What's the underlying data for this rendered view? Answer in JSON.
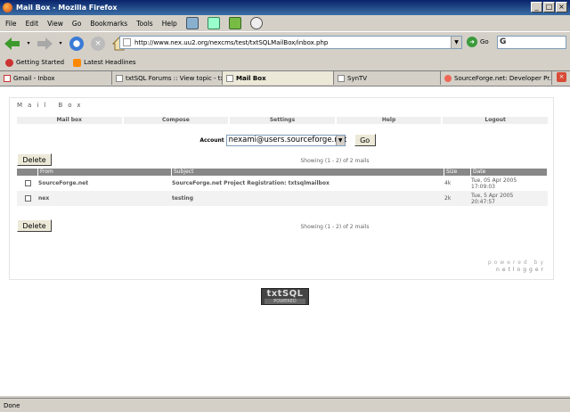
{
  "window": {
    "title": "Mail Box - Mozilla Firefox"
  },
  "menu": [
    "File",
    "Edit",
    "View",
    "Go",
    "Bookmarks",
    "Tools",
    "Help"
  ],
  "navigation": {
    "url": "http://www.nex.uu2.org/nexcms/test/txtSQLMailBox/inbox.php",
    "go_label": "Go",
    "search_icon_label": "G"
  },
  "bookmarks": [
    "Getting Started",
    "Latest Headlines"
  ],
  "tabs": [
    "Gmail - Inbox",
    "txtSQL Forums :: View topic - txt...",
    "Mail Box",
    "SynTV",
    "SourceForge.net: Developer Pr..."
  ],
  "active_tab": 2,
  "page": {
    "title": "Mail Box",
    "nav": [
      "Mail box",
      "Compose",
      "Settings",
      "Help",
      "Logout"
    ],
    "account_label": "Account",
    "account_value": "nexami@users.sourceforge.net",
    "go_button": "Go",
    "delete_button": "Delete",
    "showing_text": "Showing (1 - 2) of 2 mails",
    "columns": [
      "From",
      "Subject",
      "Size",
      "Date"
    ],
    "rows": [
      {
        "from": "SourceForge.net",
        "subject": "SourceForge.net Project Registration: txtsqlmailbox",
        "size": "4k",
        "date1": "Tue, 05 Apr 2005",
        "date2": "17:09:03"
      },
      {
        "from": "nex",
        "subject": "testing",
        "size": "2k",
        "date1": "Tue, 5 Apr 2005",
        "date2": "20:47:57"
      }
    ],
    "powered_by": "powered by",
    "powered_name": "netlogger",
    "logo_text": "txtSQL",
    "logo_sub": "POWERED"
  },
  "status": "Done"
}
